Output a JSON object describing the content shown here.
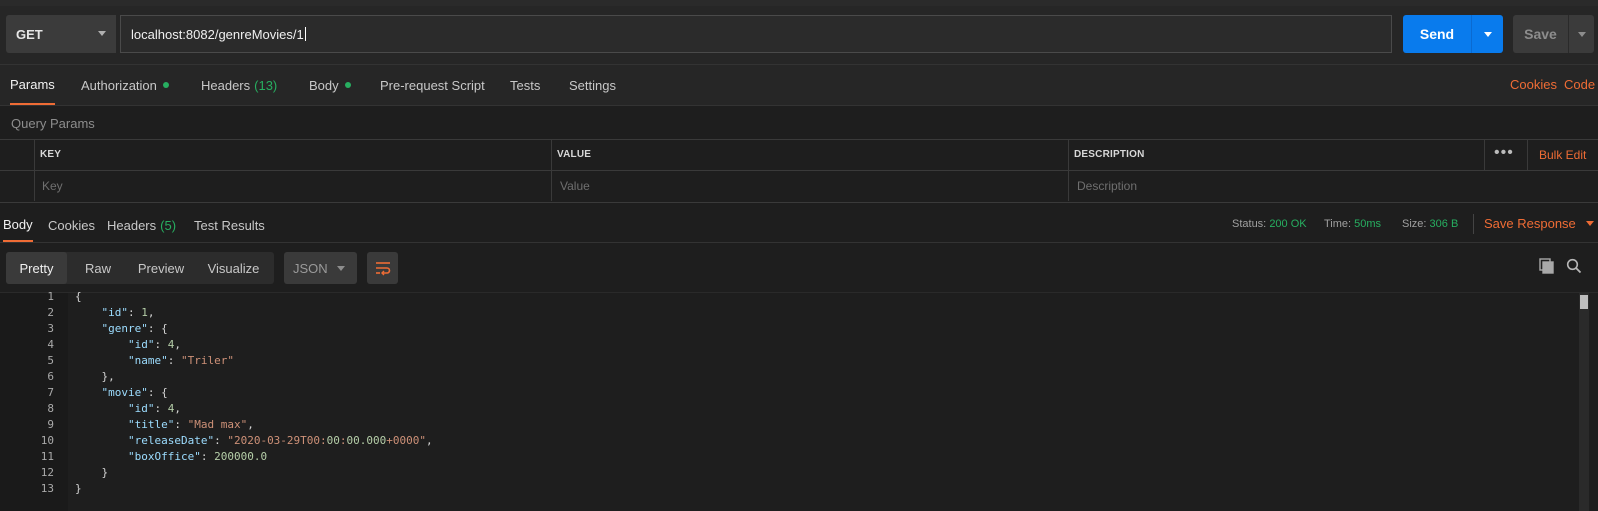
{
  "request": {
    "method": "GET",
    "url": "localhost:8082/genreMovies/1",
    "send_label": "Send",
    "save_label": "Save"
  },
  "request_tabs": [
    {
      "label": "Params",
      "active": true
    },
    {
      "label": "Authorization",
      "dot": true
    },
    {
      "label": "Headers",
      "count": "(13)"
    },
    {
      "label": "Body",
      "dot": true
    },
    {
      "label": "Pre-request Script"
    },
    {
      "label": "Tests"
    },
    {
      "label": "Settings"
    }
  ],
  "links": {
    "cookies": "Cookies",
    "code": "Code"
  },
  "query_params": {
    "title": "Query Params",
    "headers": [
      "KEY",
      "VALUE",
      "DESCRIPTION"
    ],
    "placeholders": [
      "Key",
      "Value",
      "Description"
    ],
    "more": "•••",
    "bulk_edit": "Bulk Edit"
  },
  "response_tabs": [
    {
      "label": "Body",
      "active": true
    },
    {
      "label": "Cookies"
    },
    {
      "label": "Headers",
      "count": "(5)"
    },
    {
      "label": "Test Results"
    }
  ],
  "response_meta": {
    "status_label": "Status:",
    "status_value": "200 OK",
    "time_label": "Time:",
    "time_value": "50ms",
    "size_label": "Size:",
    "size_value": "306 B",
    "save_response": "Save Response"
  },
  "view_modes": [
    "Pretty",
    "Raw",
    "Preview",
    "Visualize"
  ],
  "format": "JSON",
  "colors": {
    "accent": "#ef6c35",
    "send": "#097bed",
    "success": "#27ae60"
  },
  "code_lines": [
    "{",
    "    \"id\": 1,",
    "    \"genre\": {",
    "        \"id\": 4,",
    "        \"name\": \"Triler\"",
    "    },",
    "    \"movie\": {",
    "        \"id\": 4,",
    "        \"title\": \"Mad max\",",
    "        \"releaseDate\": \"2020-03-29T00:00:00.000+0000\",",
    "        \"boxOffice\": 200000.0",
    "    }",
    "}"
  ],
  "line_numbers": [
    "1",
    "2",
    "3",
    "4",
    "5",
    "6",
    "7",
    "8",
    "9",
    "10",
    "11",
    "12",
    "13"
  ],
  "icons": [
    "chevron-down-icon",
    "wrap-lines-icon",
    "copy-icon",
    "search-icon"
  ]
}
